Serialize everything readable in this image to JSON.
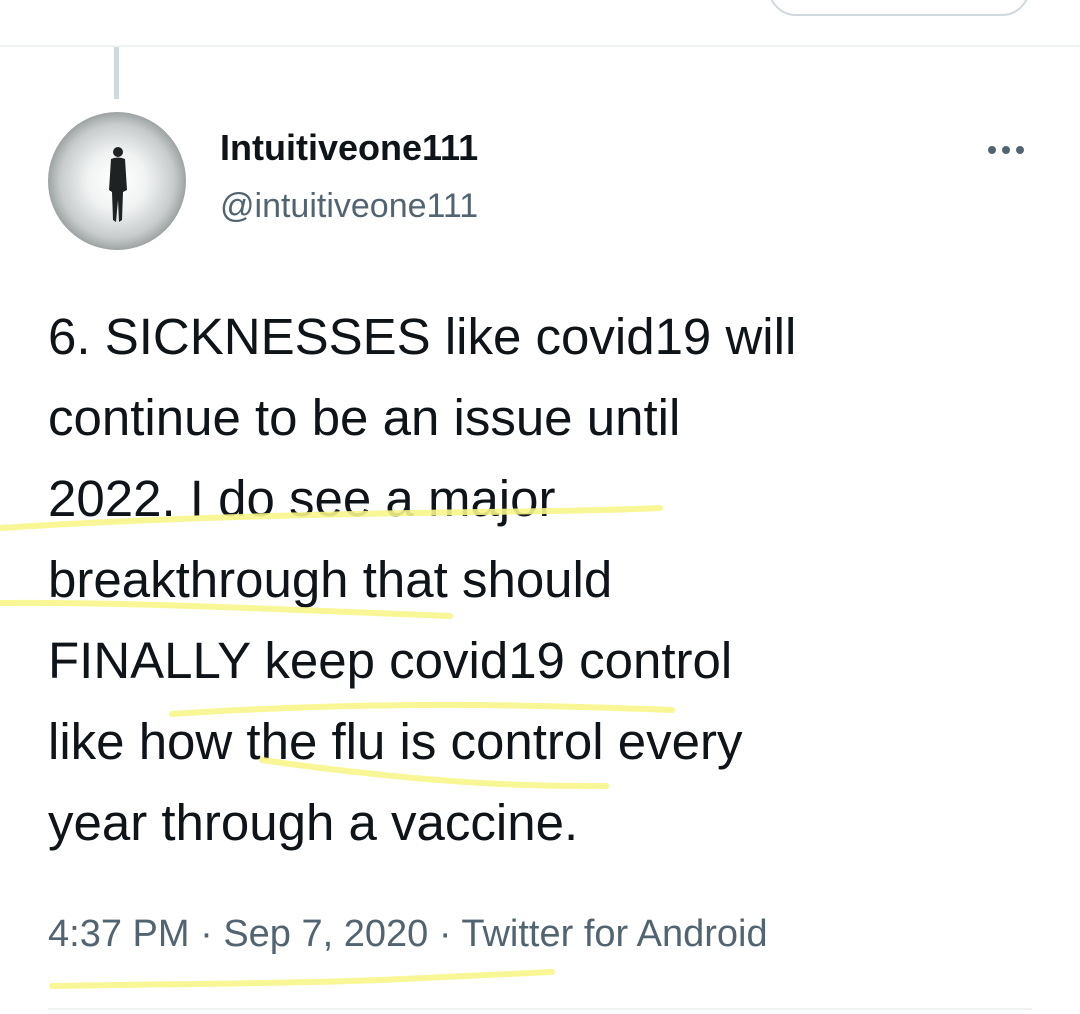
{
  "tweet": {
    "display_name": "Intuitiveone111",
    "handle": "@intuitiveone111",
    "text": "6. SICKNESSES like covid19 will\ncontinue to be an issue until\n2022. I do see a major\nbreakthrough that should\nFINALLY keep covid19 control\nlike how the flu is control every\nyear through a vaccine.",
    "time": "4:37 PM",
    "separator": "·",
    "date": "Sep 7, 2020",
    "source": "Twitter for Android",
    "more_icon": "more-horizontal-icon"
  },
  "colors": {
    "text_primary": "#0f1419",
    "text_secondary": "#536471",
    "divider": "#eff3f4",
    "highlight_marker": "#f7f58a"
  }
}
